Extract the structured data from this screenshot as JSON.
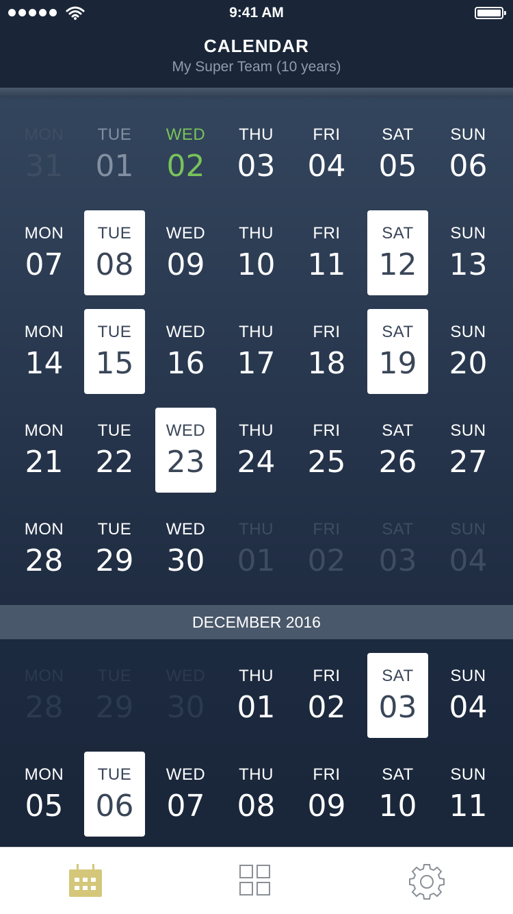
{
  "status": {
    "time": "9:41 AM",
    "signal_dots": 5,
    "battery_level": 1.0
  },
  "header": {
    "title": "CALENDAR",
    "subtitle": "My Super Team (10 years)"
  },
  "month1": {
    "rows": [
      [
        {
          "day": "MON",
          "num": "31",
          "state": "dim"
        },
        {
          "day": "TUE",
          "num": "01",
          "state": "past"
        },
        {
          "day": "WED",
          "num": "02",
          "state": "today"
        },
        {
          "day": "THU",
          "num": "03",
          "state": "normal"
        },
        {
          "day": "FRI",
          "num": "04",
          "state": "normal"
        },
        {
          "day": "SAT",
          "num": "05",
          "state": "normal"
        },
        {
          "day": "SUN",
          "num": "06",
          "state": "normal"
        }
      ],
      [
        {
          "day": "MON",
          "num": "07",
          "state": "normal"
        },
        {
          "day": "TUE",
          "num": "08",
          "state": "selected"
        },
        {
          "day": "WED",
          "num": "09",
          "state": "normal"
        },
        {
          "day": "THU",
          "num": "10",
          "state": "normal"
        },
        {
          "day": "FRI",
          "num": "11",
          "state": "normal"
        },
        {
          "day": "SAT",
          "num": "12",
          "state": "selected"
        },
        {
          "day": "SUN",
          "num": "13",
          "state": "normal"
        }
      ],
      [
        {
          "day": "MON",
          "num": "14",
          "state": "normal"
        },
        {
          "day": "TUE",
          "num": "15",
          "state": "selected"
        },
        {
          "day": "WED",
          "num": "16",
          "state": "normal"
        },
        {
          "day": "THU",
          "num": "17",
          "state": "normal"
        },
        {
          "day": "FRI",
          "num": "18",
          "state": "normal"
        },
        {
          "day": "SAT",
          "num": "19",
          "state": "selected"
        },
        {
          "day": "SUN",
          "num": "20",
          "state": "normal"
        }
      ],
      [
        {
          "day": "MON",
          "num": "21",
          "state": "normal"
        },
        {
          "day": "TUE",
          "num": "22",
          "state": "normal"
        },
        {
          "day": "WED",
          "num": "23",
          "state": "selected"
        },
        {
          "day": "THU",
          "num": "24",
          "state": "normal"
        },
        {
          "day": "FRI",
          "num": "25",
          "state": "normal"
        },
        {
          "day": "SAT",
          "num": "26",
          "state": "normal"
        },
        {
          "day": "SUN",
          "num": "27",
          "state": "normal"
        }
      ],
      [
        {
          "day": "MON",
          "num": "28",
          "state": "normal"
        },
        {
          "day": "TUE",
          "num": "29",
          "state": "normal"
        },
        {
          "day": "WED",
          "num": "30",
          "state": "normal"
        },
        {
          "day": "THU",
          "num": "01",
          "state": "dim"
        },
        {
          "day": "FRI",
          "num": "02",
          "state": "dim"
        },
        {
          "day": "SAT",
          "num": "03",
          "state": "dim"
        },
        {
          "day": "SUN",
          "num": "04",
          "state": "dim"
        }
      ]
    ]
  },
  "month_label": "DECEMBER 2016",
  "month2": {
    "rows": [
      [
        {
          "day": "MON",
          "num": "28",
          "state": "deep"
        },
        {
          "day": "TUE",
          "num": "29",
          "state": "deep"
        },
        {
          "day": "WED",
          "num": "30",
          "state": "deep"
        },
        {
          "day": "THU",
          "num": "01",
          "state": "normal"
        },
        {
          "day": "FRI",
          "num": "02",
          "state": "normal"
        },
        {
          "day": "SAT",
          "num": "03",
          "state": "selected"
        },
        {
          "day": "SUN",
          "num": "04",
          "state": "normal"
        }
      ],
      [
        {
          "day": "MON",
          "num": "05",
          "state": "normal"
        },
        {
          "day": "TUE",
          "num": "06",
          "state": "selected"
        },
        {
          "day": "WED",
          "num": "07",
          "state": "normal"
        },
        {
          "day": "THU",
          "num": "08",
          "state": "normal"
        },
        {
          "day": "FRI",
          "num": "09",
          "state": "normal"
        },
        {
          "day": "SAT",
          "num": "10",
          "state": "normal"
        },
        {
          "day": "SUN",
          "num": "11",
          "state": "normal"
        }
      ]
    ]
  },
  "tabbar": {
    "tabs": [
      {
        "icon": "calendar-icon",
        "active": true
      },
      {
        "icon": "grid-icon",
        "active": false
      },
      {
        "icon": "gear-icon",
        "active": false
      }
    ],
    "active_color": "#d4c77a",
    "inactive_color": "#8a8f96"
  },
  "colors": {
    "today": "#79c35a",
    "selected_bg": "#ffffff",
    "selected_text": "#3a4658"
  }
}
